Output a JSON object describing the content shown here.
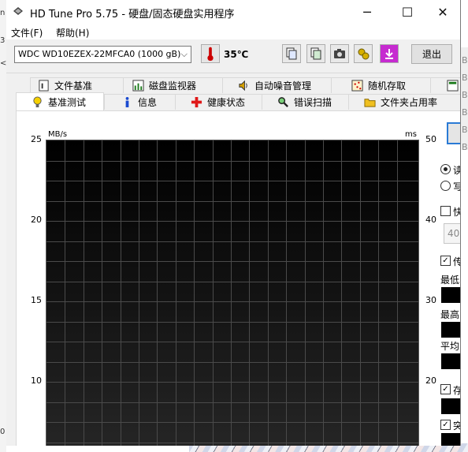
{
  "window": {
    "title": "HD Tune Pro 5.75 - 硬盘/固态硬盘实用程序",
    "controls": {
      "minimize": "─",
      "maximize": "☐",
      "close": "✕"
    }
  },
  "menu": {
    "items": [
      "文件(F)",
      "帮助(H)"
    ]
  },
  "toolbar": {
    "drive": "WDC WD10EZEX-22MFCA0 (1000 gB)",
    "temperature": "35℃",
    "exit_label": "退出",
    "icons": [
      "copy-text-icon",
      "copy-info-icon",
      "camera-icon",
      "options-icon",
      "save-icon"
    ]
  },
  "tabs": {
    "row1": [
      "文件基准",
      "磁盘监视器",
      "自动噪音管理",
      "随机存取"
    ],
    "row2": [
      "基准测试",
      "信息",
      "健康状态",
      "错误扫描",
      "文件夹占用率"
    ],
    "active": "基准测试"
  },
  "chart": {
    "left_unit": "MB/s",
    "right_unit": "ms",
    "left_ticks": [
      "25",
      "20",
      "15",
      "10"
    ],
    "right_ticks": [
      "50",
      "40",
      "30",
      "20"
    ]
  },
  "side_panel": {
    "radio_read": "读取",
    "radio_write": "写入",
    "checkbox_quick": "快捷",
    "block_value": "40",
    "checkbox_transfer": "传输",
    "min_label": "最低",
    "max_label": "最高",
    "avg_label": "平均",
    "checkbox_access": "存取",
    "checkbox_burst": "突发"
  },
  "background": {
    "left_chars": [
      "n",
      "3",
      "<",
      "0"
    ],
    "right_letters": [
      "B",
      "B",
      "B",
      "B",
      "B",
      "B",
      "B"
    ]
  },
  "chart_data": {
    "type": "line",
    "ylabel_left": "MB/s",
    "ylabel_right": "ms",
    "ylim_left": [
      0,
      25
    ],
    "ylim_right": [
      0,
      50
    ],
    "series": []
  }
}
